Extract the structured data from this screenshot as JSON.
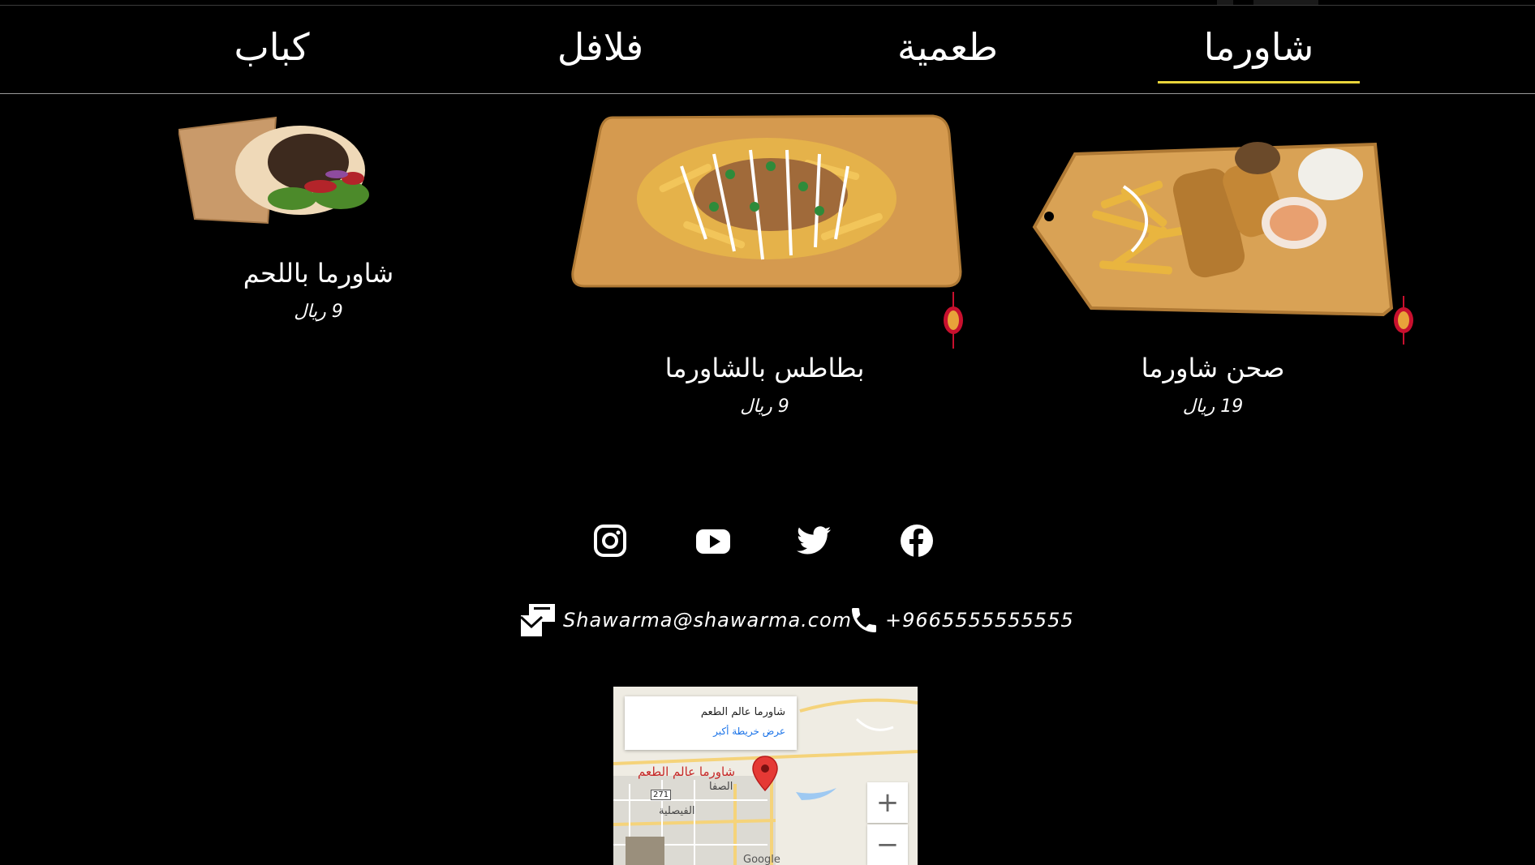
{
  "tabs": [
    {
      "label": "شاورما",
      "active": true
    },
    {
      "label": "طعمية",
      "active": false
    },
    {
      "label": "فلافل",
      "active": false
    },
    {
      "label": "كباب",
      "active": false
    }
  ],
  "menu_items": [
    {
      "name": "صحن شاورما",
      "price": "19 ريال"
    },
    {
      "name": "بطاطس بالشاورما",
      "price": "9 ريال"
    },
    {
      "name": "شاورما باللحم",
      "price": "9 ريال"
    }
  ],
  "social": [
    "facebook-icon",
    "twitter-icon",
    "youtube-icon",
    "instagram-icon"
  ],
  "contact": {
    "email": "Shawarma@shawarma.com",
    "phone": "+9665555555555"
  },
  "map": {
    "place_name": "شاورما عالم الطعم",
    "larger_map_link": "عرض خريطة أكبر",
    "marker_label": "شاورما عالم الطعم",
    "district_1": "الصفا",
    "district_2": "الفيصلية",
    "road_label": "271",
    "zoom_in": "+",
    "zoom_out": "−",
    "attribution": "Google"
  },
  "colors": {
    "accent": "#e8d43a",
    "background": "#000000",
    "link": "#1a73e8"
  }
}
